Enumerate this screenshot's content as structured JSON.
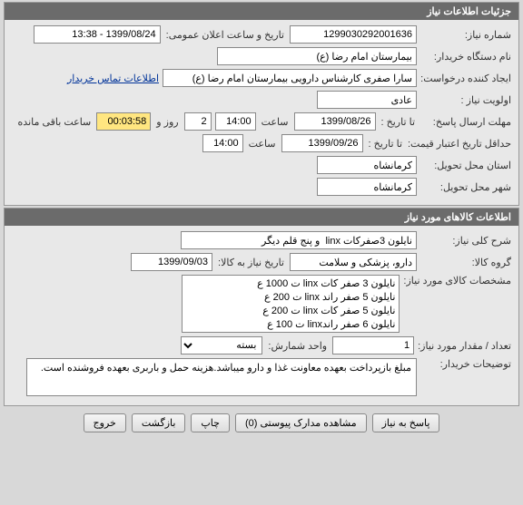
{
  "panel1": {
    "title": "جزئیات اطلاعات نیاز",
    "need_number_label": "شماره نیاز:",
    "need_number": "1299030292001636",
    "announce_label": "تاریخ و ساعت اعلان عمومی:",
    "announce_value": "1399/08/24 - 13:38",
    "buyer_label": "نام دستگاه خریدار:",
    "buyer_value": "بیمارستان امام رضا (ع)",
    "creator_label": "ایجاد کننده درخواست:",
    "creator_value": "سارا صفری کارشناس دارویی بیمارستان امام رضا (ع)",
    "contact_link": "اطلاعات تماس خریدار",
    "priority_label": "اولویت نیاز :",
    "priority_value": "عادی",
    "deadline_label": "مهلت ارسال پاسخ:",
    "to_date_label": "تا تاریخ :",
    "deadline_date": "1399/08/26",
    "time_label": "ساعت",
    "deadline_time": "14:00",
    "days_value": "2",
    "days_label": "روز و",
    "remain_time": "00:03:58",
    "remain_label": "ساعت باقی مانده",
    "min_valid_label": "حداقل تاریخ اعتبار قیمت:",
    "min_valid_date": "1399/09/26",
    "min_valid_time": "14:00",
    "province_label": "استان محل تحویل:",
    "province_value": "کرمانشاه",
    "city_label": "شهر محل تحویل:",
    "city_value": "کرمانشاه"
  },
  "panel2": {
    "title": "اطلاعات کالاهای مورد نیاز",
    "desc_label": "شرح کلی نیاز:",
    "desc_value": "نایلون 3صفرکات linx  و پنج قلم دیگر",
    "group_label": "گروه کالا:",
    "group_value": "دارو، پزشکی و سلامت",
    "need_date_label": "تاریخ نیاز به کالا:",
    "need_date_value": "1399/09/03",
    "spec_label": "مشخصات کالای مورد نیاز:",
    "spec_items": [
      "نایلون 3 صفر کات linx ت 1000 ع",
      "نایلون 5 صفر راند linx ت 200 ع",
      "نایلون 5 صفر کات linx ت 200 ع",
      "نایلون 6 صفر راندlinx ت 100 ع"
    ],
    "qty_label": "تعداد / مقدار مورد نیاز:",
    "qty_value": "1",
    "unit_label": "واحد شمارش:",
    "unit_value": "بسته",
    "notes_label": "توضیحات خریدار:",
    "notes_value": "مبلغ بازپرداخت بعهده معاونت غذا و دارو میباشد.هزینه حمل و باربری بعهده فروشنده است."
  },
  "buttons": {
    "reply": "پاسخ به نیاز",
    "attach": "مشاهده مدارک پیوستی (0)",
    "print": "چاپ",
    "back": "بازگشت",
    "exit": "خروج"
  }
}
